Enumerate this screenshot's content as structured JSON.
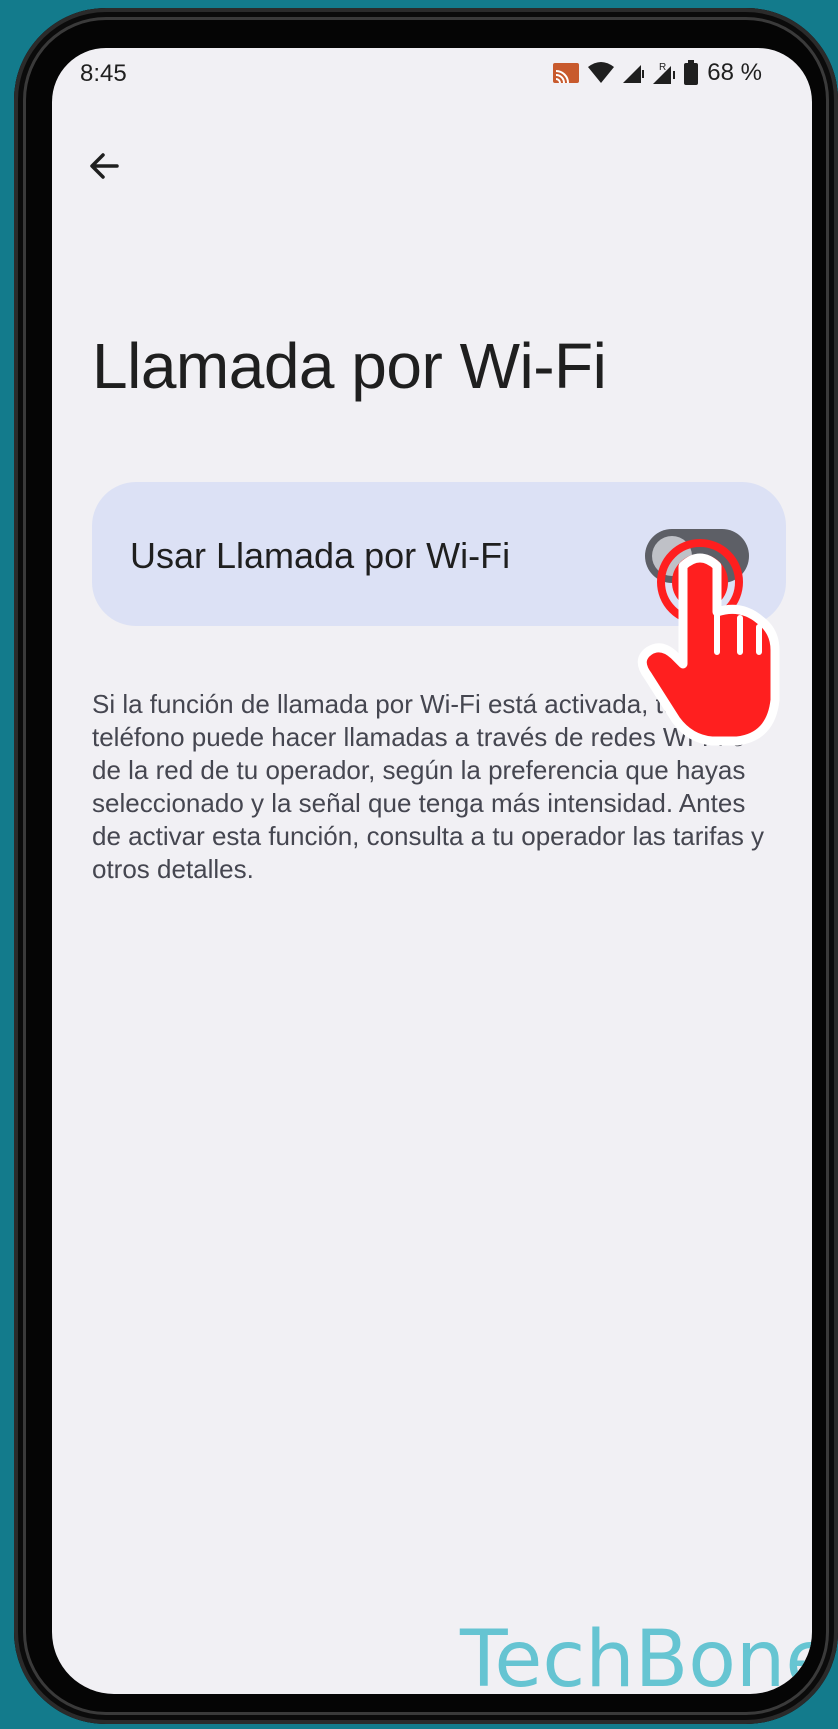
{
  "status_bar": {
    "time": "8:45",
    "battery_text": "68 %",
    "icons": [
      "cast-icon",
      "wifi-icon",
      "cellular-signal-icon",
      "roaming-signal-icon",
      "battery-icon"
    ]
  },
  "header": {
    "back_icon": "arrow-left-icon",
    "title": "Llamada por Wi-Fi"
  },
  "setting": {
    "label": "Usar Llamada por Wi-Fi",
    "enabled": false
  },
  "description": "Si la función de llamada por Wi-Fi está activada, tu teléfono puede hacer llamadas a través de redes Wi-Fi o de la red de tu operador, según la preferencia que hayas seleccionado y la señal que tenga más intensidad. Antes de activar esta función, consulta a tu operador las tarifas y otros detalles.",
  "watermark": "TechBone",
  "colors": {
    "background": "#137b8c",
    "screen": "#f1f0f4",
    "card": "#dce1f5",
    "toggle_off": "#5d5f66",
    "tap_indicator": "#ff1f1f",
    "watermark": "#57c0cf"
  }
}
